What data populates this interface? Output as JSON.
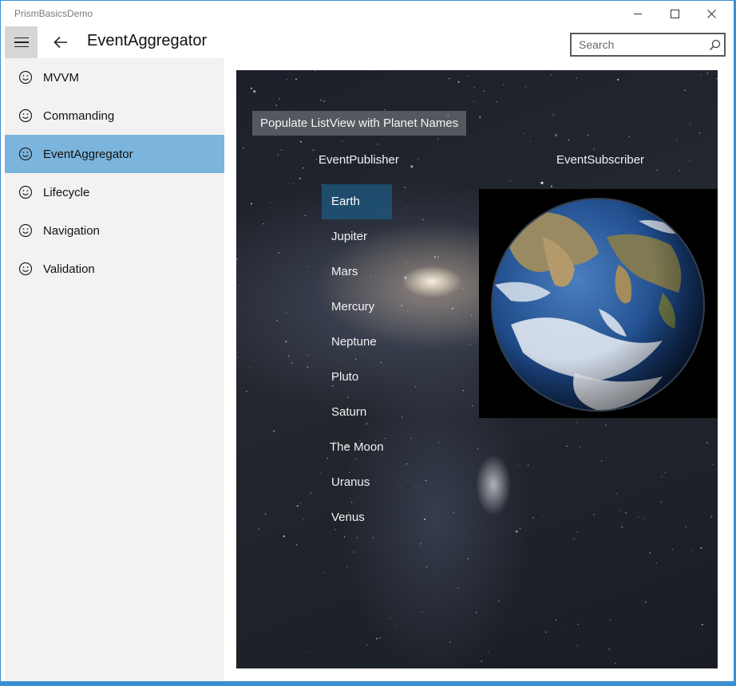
{
  "window": {
    "title": "PrismBasicsDemo",
    "controls": {
      "minimize": "minimize",
      "maximize": "maximize",
      "close": "close"
    }
  },
  "header": {
    "title": "EventAggregator",
    "search_placeholder": "Search"
  },
  "sidebar": {
    "items": [
      {
        "label": "MVVM",
        "icon": "smiley-icon",
        "selected": false
      },
      {
        "label": "Commanding",
        "icon": "smiley-icon",
        "selected": false
      },
      {
        "label": "EventAggregator",
        "icon": "smiley-icon",
        "selected": true
      },
      {
        "label": "Lifecycle",
        "icon": "smiley-icon",
        "selected": false
      },
      {
        "label": "Navigation",
        "icon": "smiley-icon",
        "selected": false
      },
      {
        "label": "Validation",
        "icon": "smiley-icon",
        "selected": false
      }
    ]
  },
  "main": {
    "populate_button": "Populate ListView with Planet Names",
    "publisher_header": "EventPublisher",
    "subscriber_header": "EventSubscriber",
    "planets": [
      "Earth",
      "Jupiter",
      "Mars",
      "Mercury",
      "Neptune",
      "Pluto",
      "Saturn",
      "The Moon",
      "Uranus",
      "Venus"
    ],
    "selected_planet": "Earth"
  },
  "colors": {
    "accent": "#7bb4dc",
    "list_selection": "#1e5478",
    "sidebar_bg": "#f2f2f2",
    "window_border": "#3b8fd1"
  }
}
